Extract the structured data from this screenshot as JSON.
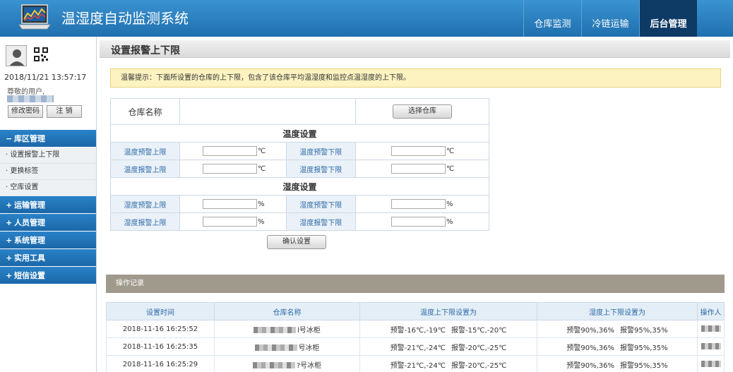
{
  "header": {
    "title": "温湿度自动监测系统",
    "tabs": [
      {
        "label": "仓库监测",
        "active": false
      },
      {
        "label": "冷链运输",
        "active": false
      },
      {
        "label": "后台管理",
        "active": true
      }
    ]
  },
  "user": {
    "datetime": "2018/11/21 13:57:17",
    "greeting": "尊敬的用户,",
    "change_password": "修改密码",
    "logout": "注 销"
  },
  "sidebar": {
    "groups": [
      {
        "sign": "−",
        "label": "库区管理",
        "items": [
          "设置报警上下限",
          "更换标签",
          "空库设置"
        ]
      },
      {
        "sign": "+",
        "label": "运输管理"
      },
      {
        "sign": "+",
        "label": "人员管理"
      },
      {
        "sign": "+",
        "label": "系统管理"
      },
      {
        "sign": "+",
        "label": "实用工具"
      },
      {
        "sign": "+",
        "label": "短信设置"
      }
    ]
  },
  "main": {
    "title": "设置报警上下限",
    "tip": "温馨提示：下面所设置的仓库的上下限，包含了该仓库平均温湿度和监控点温湿度的上下限。",
    "form": {
      "warehouse_label": "仓库名称",
      "select_button": "选择仓库",
      "temp_section": "温度设置",
      "humid_section": "湿度设置",
      "temp_warn_upper": "温度预警上限",
      "temp_warn_lower": "温度预警下限",
      "temp_alarm_upper": "温度报警上限",
      "temp_alarm_lower": "温度报警下限",
      "humid_warn_upper": "湿度预警上限",
      "humid_warn_lower": "湿度预警下限",
      "humid_alarm_upper": "湿度报警上限",
      "humid_alarm_lower": "湿度报警下限",
      "unit_temp": "℃",
      "unit_humid": "%",
      "confirm_button": "确认设置"
    },
    "ops_title": "操作记录",
    "log": {
      "headers": [
        "设置时间",
        "仓库名称",
        "温度上下限设置为",
        "湿度上下限设置为",
        "操作人"
      ],
      "rows": [
        {
          "time": "2018-11-16 16:25:52",
          "name_suffix": "l号冰柜",
          "temp_warn": "预警-16℃,-19℃",
          "temp_alarm": "报警-15℃,-20℃",
          "humid_warn": "预警90%,36%",
          "humid_alarm": "报警95%,35%"
        },
        {
          "time": "2018-11-16 16:25:35",
          "name_suffix": "号冰柜",
          "temp_warn": "预警-21℃,-24℃",
          "temp_alarm": "报警-20℃,-25℃",
          "humid_warn": "预警90%,36%",
          "humid_alarm": "报警95%,35%"
        },
        {
          "time": "2018-11-16 16:25:29",
          "name_suffix": "?号冰柜",
          "temp_warn": "预警-21℃,-24℃",
          "temp_alarm": "报警-20℃,-25℃",
          "humid_warn": "预警90%,36%",
          "humid_alarm": "报警95%,35%"
        }
      ]
    }
  }
}
